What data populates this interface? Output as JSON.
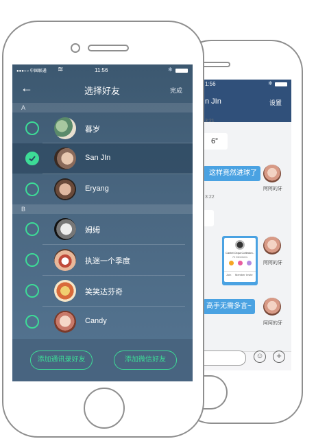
{
  "front": {
    "status": {
      "carrier": "●●●○○ 中国联通",
      "wifi_icon": "wifi-icon",
      "time": "11:56",
      "bluetooth_icon": "bluetooth-icon",
      "battery_icon": "battery-icon"
    },
    "nav": {
      "back_icon": "arrow-left-icon",
      "title": "选择好友",
      "done_label": "完成"
    },
    "sections": [
      {
        "header": "A",
        "contacts": [
          {
            "name": "暮岁",
            "selected": false
          },
          {
            "name": "San JIn",
            "selected": true
          },
          {
            "name": "Eryang",
            "selected": false
          }
        ]
      },
      {
        "header": "B",
        "contacts": [
          {
            "name": "姆姆",
            "selected": false
          },
          {
            "name": "执迷一个季度",
            "selected": false
          },
          {
            "name": "笑笑达芬奇",
            "selected": false
          },
          {
            "name": "Candy",
            "selected": false
          }
        ]
      }
    ],
    "buttons": {
      "add_contacts": "添加通讯录好友",
      "add_wechat": "添加微信好友"
    }
  },
  "back": {
    "status": {
      "time": "1:56"
    },
    "nav": {
      "title": "n JIn",
      "settings": "设置"
    },
    "messages": [
      {
        "time": "3:21"
      },
      {
        "text": "6”"
      },
      {
        "text": "这样竟然进球了",
        "sender": "阿阿的牙"
      },
      {
        "time": "3:22"
      },
      {
        "card_title": "Cantel Oxpa Cottedon...",
        "card_sub": "72 Members",
        "card_footer": [
          "Join",
          "Member",
          "Invite"
        ],
        "sender": "阿阿的牙"
      },
      {
        "text": "高手无需多言~",
        "sender": "阿阿的牙"
      }
    ],
    "input": {
      "emoji_icon": "smiley-icon",
      "plus_icon": "plus-icon"
    }
  },
  "colors": {
    "accent_green": "#3ddc97",
    "nav_blue": "#30507a",
    "bubble_blue": "#4aa2e2"
  }
}
